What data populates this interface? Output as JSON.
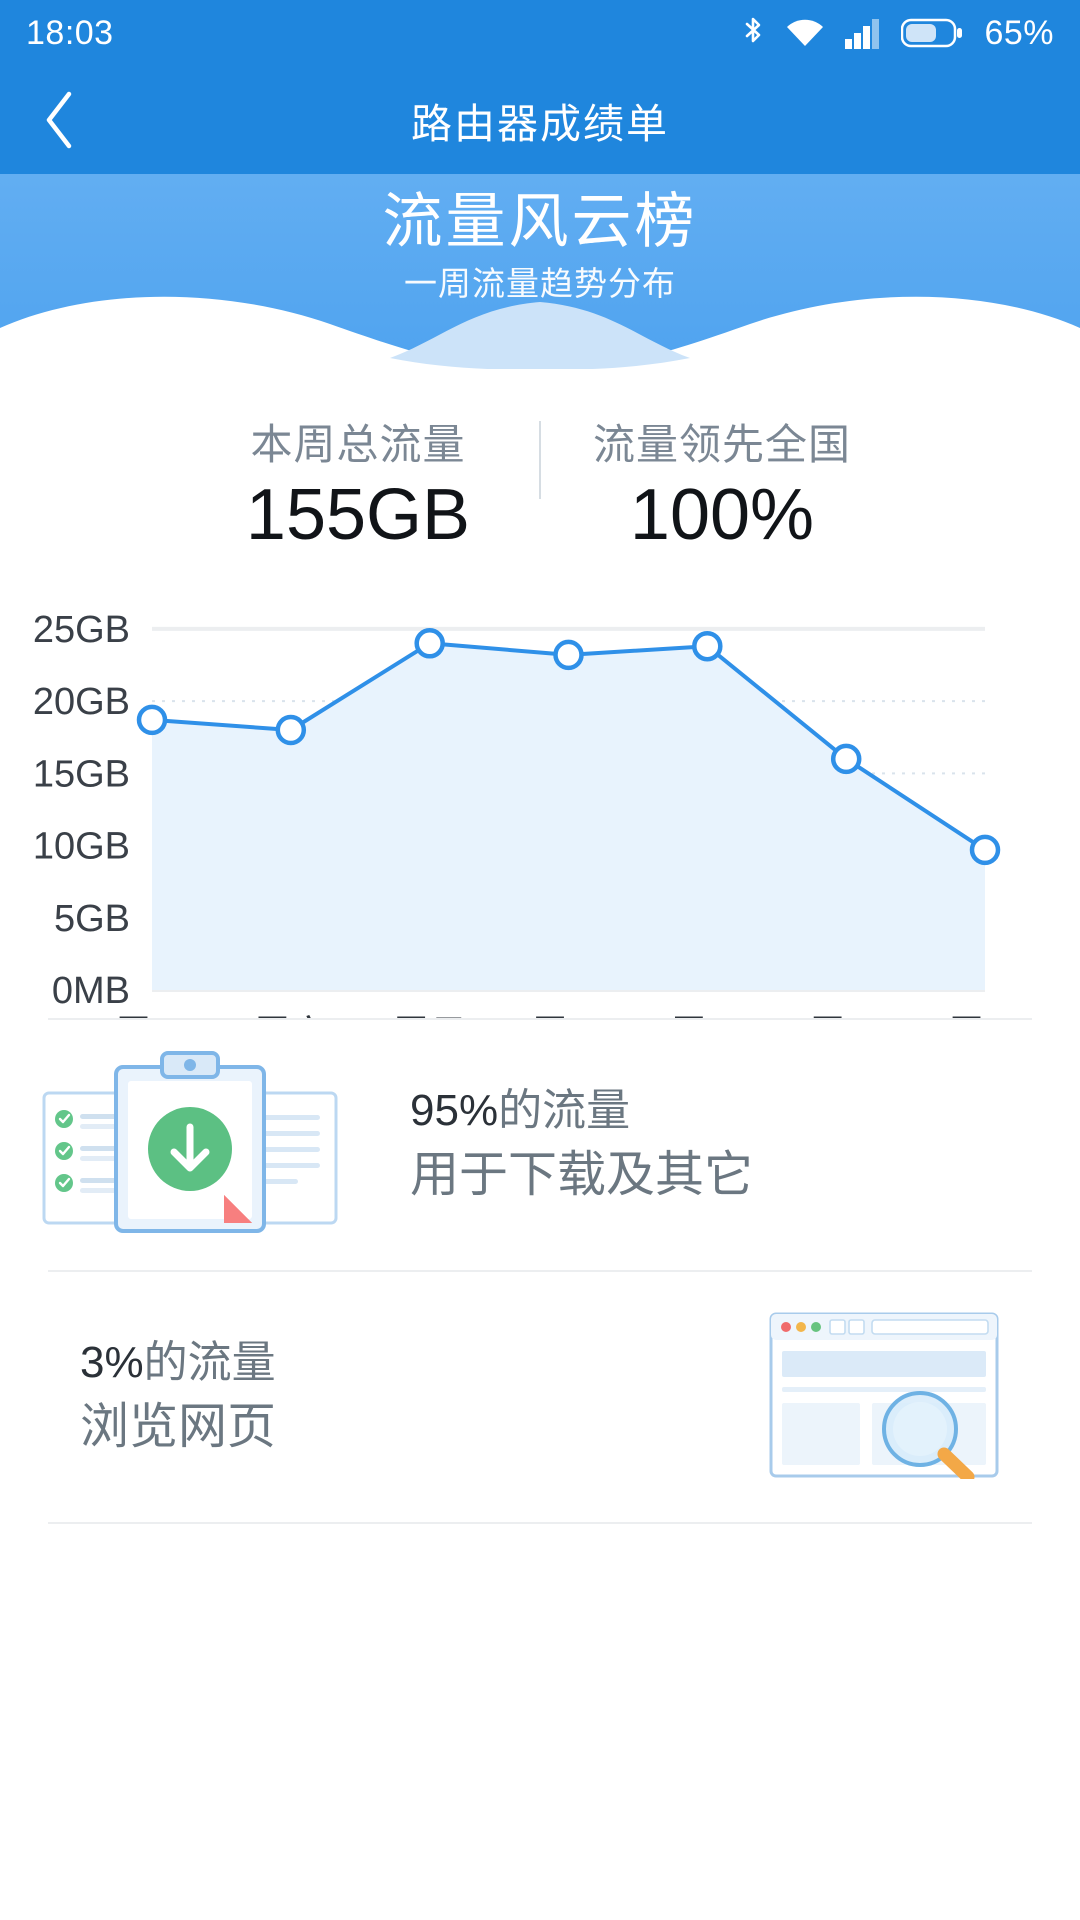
{
  "statusbar": {
    "time": "18:03",
    "battery_percent": "65%",
    "icons": [
      "bluetooth-icon",
      "wifi-icon",
      "signal-icon",
      "battery-icon"
    ]
  },
  "appbar": {
    "back_icon": "chevron-left-icon",
    "title": "路由器成绩单"
  },
  "hero": {
    "title": "流量风云榜",
    "subtitle": "一周流量趋势分布",
    "bg_color": "#4fa3ef"
  },
  "stats": [
    {
      "label": "本周总流量",
      "value": "155GB"
    },
    {
      "label": "流量领先全国",
      "value": "100%"
    }
  ],
  "chart_data": {
    "type": "area",
    "title": "",
    "xlabel": "",
    "ylabel": "",
    "categories": [
      "周五",
      "周六",
      "周日",
      "周一",
      "周二",
      "周三",
      "周四"
    ],
    "values": [
      18.7,
      18.0,
      24.0,
      23.2,
      23.8,
      16.0,
      9.7
    ],
    "series": [
      {
        "name": "一周流量趋势分布",
        "values": [
          18.7,
          18.0,
          24.0,
          23.2,
          23.8,
          16.0,
          9.7
        ]
      }
    ],
    "ytick_labels": [
      "25GB",
      "20GB",
      "15GB",
      "10GB",
      "5GB",
      "0MB"
    ],
    "ytick_values": [
      25,
      20,
      15,
      10,
      5,
      0
    ],
    "ylim": [
      0,
      27
    ],
    "grid": true,
    "grid_style": "dotted",
    "legend": "none",
    "line_color": "#2f90e8",
    "fill_color": "#e8f3fd",
    "marker": "open-circle"
  },
  "info_rows": [
    {
      "illustration": "clipboard-download-icon",
      "percent": "95%",
      "line1_suffix": "的流量",
      "line2": "用于下载及其它"
    },
    {
      "illustration": "browser-search-icon",
      "percent": "3%",
      "line1_suffix": "的流量",
      "line2": "浏览网页"
    }
  ]
}
